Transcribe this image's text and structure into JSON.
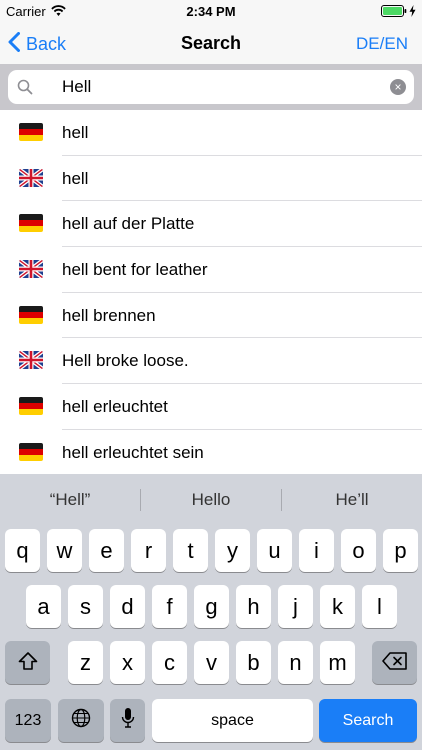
{
  "status_bar": {
    "carrier": "Carrier",
    "time": "2:34 PM"
  },
  "nav": {
    "back_label": "Back",
    "title": "Search",
    "language_toggle": "DE/EN"
  },
  "search": {
    "value": "Hell"
  },
  "results": [
    {
      "flag": "de",
      "text": "hell"
    },
    {
      "flag": "gb",
      "text": "hell"
    },
    {
      "flag": "de",
      "text": "hell auf der Platte"
    },
    {
      "flag": "gb",
      "text": "hell bent for leather"
    },
    {
      "flag": "de",
      "text": "hell brennen"
    },
    {
      "flag": "gb",
      "text": "Hell broke loose."
    },
    {
      "flag": "de",
      "text": "hell erleuchtet"
    },
    {
      "flag": "de",
      "text": "hell erleuchtet sein"
    }
  ],
  "keyboard": {
    "suggestions": [
      "“Hell”",
      "Hello",
      "He’ll"
    ],
    "row1": [
      "q",
      "w",
      "e",
      "r",
      "t",
      "y",
      "u",
      "i",
      "o",
      "p"
    ],
    "row2": [
      "a",
      "s",
      "d",
      "f",
      "g",
      "h",
      "j",
      "k",
      "l"
    ],
    "row3": [
      "z",
      "x",
      "c",
      "v",
      "b",
      "n",
      "m"
    ],
    "numbers_key": "123",
    "space_key": "space",
    "search_key": "Search"
  },
  "colors": {
    "accent": "#1a7ef7",
    "keyboard_bg": "#d1d4db"
  }
}
